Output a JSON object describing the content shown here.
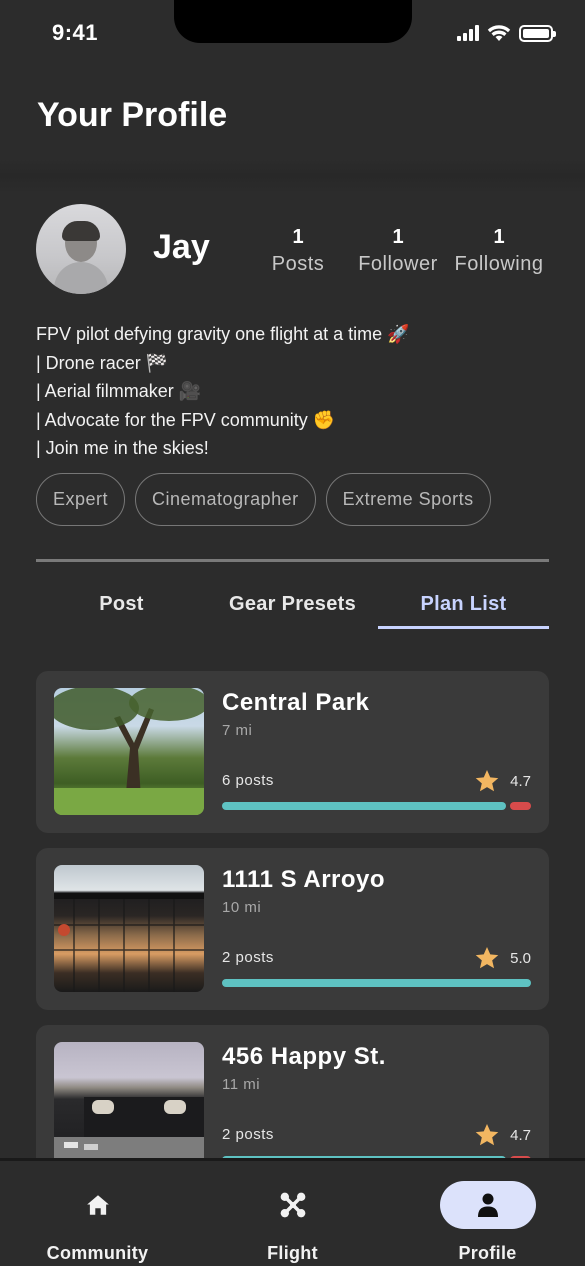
{
  "status_bar": {
    "time": "9:41"
  },
  "header": {
    "title": "Your Profile"
  },
  "profile": {
    "name": "Jay",
    "stats": [
      {
        "value": "1",
        "label": "Posts"
      },
      {
        "value": "1",
        "label": "Follower"
      },
      {
        "value": "1",
        "label": "Following"
      }
    ],
    "bio": [
      "FPV pilot defying gravity one flight at a time 🚀",
      "| Drone racer 🏁",
      "| Aerial filmmaker 🎥",
      "| Advocate for the FPV community ✊",
      "| Join me in the skies!"
    ],
    "tags": [
      "Expert",
      "Cinematographer",
      "Extreme Sports"
    ]
  },
  "tabs": [
    {
      "label": "Post",
      "active": false
    },
    {
      "label": "Gear Presets",
      "active": false
    },
    {
      "label": "Plan List",
      "active": true
    }
  ],
  "plans": [
    {
      "title": "Central Park",
      "distance": "7 mi",
      "posts": "6 posts",
      "rating": "4.7",
      "positive_fraction": 0.93,
      "image": "park-photo"
    },
    {
      "title": "1111 S Arroyo",
      "distance": "10 mi",
      "posts": "2 posts",
      "rating": "5.0",
      "positive_fraction": 1.0,
      "image": "building-photo"
    },
    {
      "title": "456 Happy St.",
      "distance": "11 mi",
      "posts": "2 posts",
      "rating": "4.7",
      "positive_fraction": 0.93,
      "image": "house-photo"
    }
  ],
  "colors": {
    "accent": "#c8d3ff",
    "positive": "#5ec2c2",
    "negative": "#d74b4b",
    "star": "#f2b661"
  },
  "bottom_nav": [
    {
      "label": "Community",
      "icon": "home-icon",
      "active": false
    },
    {
      "label": "Flight",
      "icon": "drone-icon",
      "active": false
    },
    {
      "label": "Profile",
      "icon": "person-icon",
      "active": true
    }
  ]
}
